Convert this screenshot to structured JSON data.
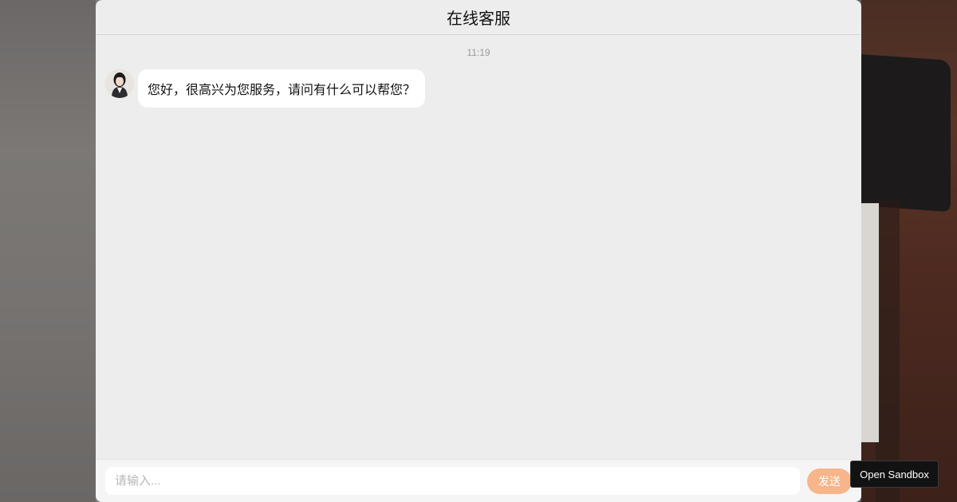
{
  "header": {
    "title": "在线客服"
  },
  "chat": {
    "timestamp": "11:19",
    "messages": [
      {
        "sender": "agent",
        "avatar_icon": "agent-avatar",
        "text": "您好，很高兴为您服务，请问有什么可以帮您？"
      }
    ]
  },
  "composer": {
    "placeholder": "请输入...",
    "value": "",
    "send_label": "发送"
  },
  "overlay": {
    "sandbox_label": "Open Sandbox"
  },
  "colors": {
    "window_bg": "#ededed",
    "bubble_bg": "#ffffff",
    "send_button": "#f7b58a",
    "tooltip_bg": "#121212"
  }
}
